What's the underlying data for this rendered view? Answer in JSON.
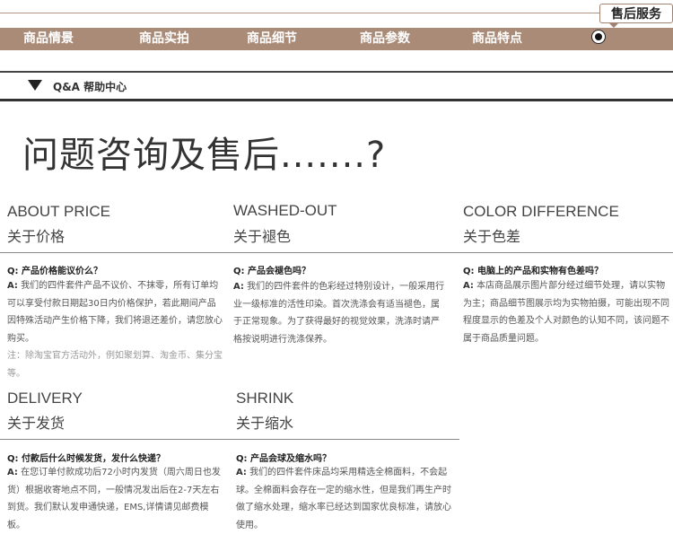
{
  "header": {
    "aftersales_tab": "售后服务",
    "nav": [
      "商品情景",
      "商品实拍",
      "商品细节",
      "商品参数",
      "商品特点"
    ],
    "qa_label": "Q&A  帮助中心"
  },
  "page_title": "问题咨询及售后.......?",
  "sections": [
    {
      "en": "ABOUT PRICE",
      "zh": "关于价格",
      "question": "Q: 产品价格能议价么？",
      "answer_prefix": "A:",
      "answer": "我们的四件套件产品不议价、不抹零，所有订单均可以享受付款日期起30日内价格保护，若此期间产品因特殊活动产生价格下降，我们将退还差价，请您放心购买。",
      "note": "注：除淘宝官方活动外，例如聚划算、淘金币、集分宝等。"
    },
    {
      "en": "WASHED-OUT",
      "zh": "关于褪色",
      "question": "Q: 产品会褪色吗？",
      "answer_prefix": "A:",
      "answer": "我们的四件套件的色彩经过特别设计，一般采用行业一级标准的活性印染。首次洗涤会有适当褪色，属于正常现象。为了获得最好的视觉效果，洗涤时请严格按说明进行洗涤保养。"
    },
    {
      "en": "COLOR DIFFERENCE",
      "zh": "关于色差",
      "question": "Q: 电脑上的产品和实物有色差吗？",
      "answer_prefix": "A:",
      "answer": "本店商品展示图片部分经过细节处理，请以实物为主；商品细节图展示均为实物拍摄，可能出现不同程度显示的色差及个人对颜色的认知不同，该问题不属于商品质量问题。"
    },
    {
      "en": "DELIVERY",
      "zh": "关于发货",
      "question": "Q: 付款后什么时候发货，发什么快递？",
      "answer_prefix": "A:",
      "answer": "在您订单付款成功后72小时内发货（周六周日也发货）根据收寄地点不同，一般情况发出后在2-7天左右到货。我们默认发申通快递，EMS,详情请见邮费模板。"
    },
    {
      "en": "SHRINK",
      "zh": "关于缩水",
      "question": "Q: 产品会球及缩水吗？",
      "answer_prefix": "A:",
      "answer": "我们的四件套件床品均采用精选全棉面料，不会起球。全棉面料会存在一定的缩水性，但是我们再生产时做了缩水处理，缩水率已经达到国家优良标准，请放心使用。"
    }
  ],
  "colors": {
    "nav_bg": "#a98b78",
    "nav_text": "#ffffff",
    "rule": "#333333"
  }
}
